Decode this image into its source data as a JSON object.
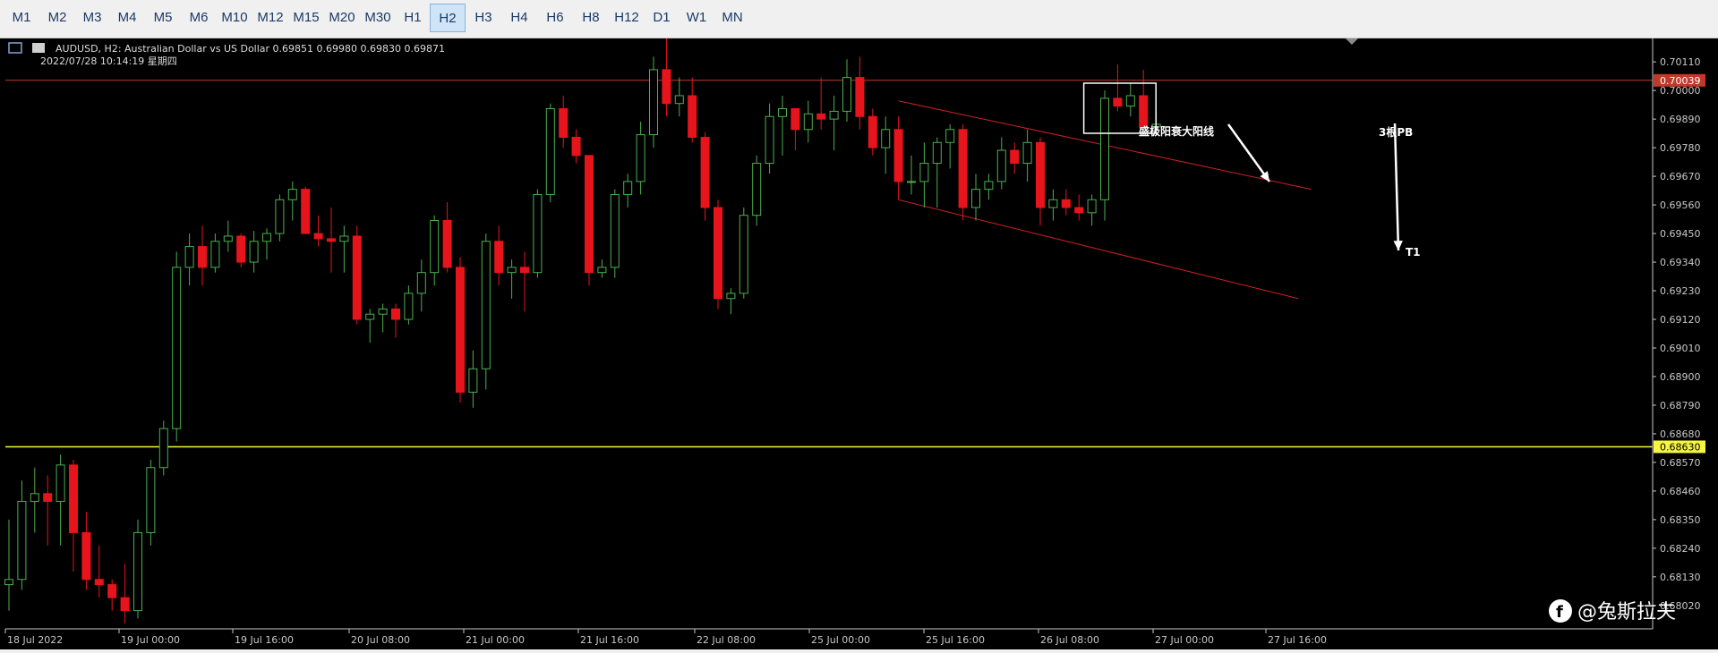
{
  "toolbar": {
    "timeframes": [
      "M1",
      "M2",
      "M3",
      "M4",
      "M5",
      "M6",
      "M10",
      "M12",
      "M15",
      "M20",
      "M30",
      "H1",
      "H2",
      "H3",
      "H4",
      "H6",
      "H8",
      "H12",
      "D1",
      "W1",
      "MN"
    ],
    "active": "H2"
  },
  "chart_header": {
    "symbol_line": "AUDUSD, H2:  Australian Dollar vs US Dollar  0.69851 0.69980 0.69830 0.69871",
    "datetime_line": "2022/07/28  10:14:19  星期四"
  },
  "annotations": {
    "label_big_candle": "盛极阳衰大阳线",
    "label_3pb": "3根PB",
    "label_t1": "T1"
  },
  "watermark": {
    "text": "@兔斯拉夫",
    "icon": "facebook-icon"
  },
  "colors": {
    "bull": "#4caf50",
    "bear": "#e8141c",
    "grid_text": "#c8c8c8",
    "support": "#f5f542",
    "resistance": "#c0392b",
    "channel": "#d02020"
  },
  "chart_data": {
    "type": "candlestick",
    "symbol": "AUDUSD",
    "timeframe": "H2",
    "y_ticks": [
      0.7011,
      0.7,
      0.6989,
      0.6978,
      0.6967,
      0.6956,
      0.6945,
      0.6934,
      0.6923,
      0.6912,
      0.6901,
      0.689,
      0.6879,
      0.6868,
      0.6857,
      0.6846,
      0.6835,
      0.6824,
      0.6813,
      0.6802
    ],
    "ylim": [
      0.6793,
      0.702
    ],
    "x_labels": [
      "18 Jul 2022",
      "19 Jul 00:00",
      "19 Jul 16:00",
      "20 Jul 08:00",
      "21 Jul 00:00",
      "21 Jul 16:00",
      "22 Jul 08:00",
      "25 Jul 00:00",
      "25 Jul 16:00",
      "26 Jul 08:00",
      "27 Jul 00:00",
      "27 Jul 16:00"
    ],
    "current_price": 0.70039,
    "support_level": 0.6863,
    "candles": [
      [
        0.681,
        0.6835,
        0.68,
        0.6812
      ],
      [
        0.6812,
        0.685,
        0.6808,
        0.6842
      ],
      [
        0.6842,
        0.6855,
        0.683,
        0.6845
      ],
      [
        0.6845,
        0.6852,
        0.6825,
        0.6842
      ],
      [
        0.6842,
        0.686,
        0.6825,
        0.6856
      ],
      [
        0.6856,
        0.6858,
        0.6815,
        0.683
      ],
      [
        0.683,
        0.6838,
        0.6808,
        0.6812
      ],
      [
        0.6812,
        0.6825,
        0.6805,
        0.681
      ],
      [
        0.681,
        0.6812,
        0.68,
        0.6805
      ],
      [
        0.6805,
        0.6818,
        0.6795,
        0.68
      ],
      [
        0.68,
        0.6835,
        0.6797,
        0.683
      ],
      [
        0.683,
        0.6858,
        0.6825,
        0.6855
      ],
      [
        0.6855,
        0.6873,
        0.6852,
        0.687
      ],
      [
        0.687,
        0.6938,
        0.6865,
        0.6932
      ],
      [
        0.6932,
        0.6945,
        0.6925,
        0.694
      ],
      [
        0.694,
        0.6948,
        0.6925,
        0.6932
      ],
      [
        0.6932,
        0.6945,
        0.693,
        0.6942
      ],
      [
        0.6942,
        0.695,
        0.6938,
        0.6944
      ],
      [
        0.6944,
        0.6945,
        0.6932,
        0.6934
      ],
      [
        0.6934,
        0.6946,
        0.693,
        0.6942
      ],
      [
        0.6942,
        0.6947,
        0.6935,
        0.6945
      ],
      [
        0.6945,
        0.696,
        0.6942,
        0.6958
      ],
      [
        0.6958,
        0.6965,
        0.695,
        0.6962
      ],
      [
        0.6962,
        0.6963,
        0.6945,
        0.6945
      ],
      [
        0.6945,
        0.6952,
        0.694,
        0.6943
      ],
      [
        0.6943,
        0.6955,
        0.693,
        0.6942
      ],
      [
        0.6942,
        0.6948,
        0.693,
        0.6944
      ],
      [
        0.6944,
        0.6948,
        0.691,
        0.6912
      ],
      [
        0.6912,
        0.6916,
        0.6903,
        0.6914
      ],
      [
        0.6914,
        0.6918,
        0.6907,
        0.6916
      ],
      [
        0.6916,
        0.6918,
        0.6905,
        0.6912
      ],
      [
        0.6912,
        0.6925,
        0.691,
        0.6922
      ],
      [
        0.6922,
        0.6935,
        0.6915,
        0.693
      ],
      [
        0.693,
        0.6952,
        0.6925,
        0.695
      ],
      [
        0.695,
        0.6957,
        0.693,
        0.6932
      ],
      [
        0.6932,
        0.6936,
        0.688,
        0.6884
      ],
      [
        0.6884,
        0.69,
        0.6878,
        0.6893
      ],
      [
        0.6893,
        0.6945,
        0.6885,
        0.6942
      ],
      [
        0.6942,
        0.6948,
        0.6925,
        0.693
      ],
      [
        0.693,
        0.6935,
        0.692,
        0.6932
      ],
      [
        0.6932,
        0.6938,
        0.6915,
        0.693
      ],
      [
        0.693,
        0.6962,
        0.6928,
        0.696
      ],
      [
        0.696,
        0.6995,
        0.6957,
        0.6993
      ],
      [
        0.6993,
        0.6998,
        0.6978,
        0.6982
      ],
      [
        0.6982,
        0.6985,
        0.6972,
        0.6975
      ],
      [
        0.6975,
        0.6975,
        0.6925,
        0.693
      ],
      [
        0.693,
        0.6935,
        0.6928,
        0.6932
      ],
      [
        0.6932,
        0.6962,
        0.6928,
        0.696
      ],
      [
        0.696,
        0.6968,
        0.6955,
        0.6965
      ],
      [
        0.6965,
        0.6988,
        0.696,
        0.6983
      ],
      [
        0.6983,
        0.7013,
        0.6978,
        0.7008
      ],
      [
        0.7008,
        0.702,
        0.699,
        0.6995
      ],
      [
        0.6995,
        0.7005,
        0.699,
        0.6998
      ],
      [
        0.6998,
        0.7005,
        0.698,
        0.6982
      ],
      [
        0.6982,
        0.6984,
        0.695,
        0.6955
      ],
      [
        0.6955,
        0.6958,
        0.6916,
        0.692
      ],
      [
        0.692,
        0.6924,
        0.6914,
        0.6922
      ],
      [
        0.6922,
        0.6955,
        0.692,
        0.6952
      ],
      [
        0.6952,
        0.6975,
        0.6948,
        0.6972
      ],
      [
        0.6972,
        0.6995,
        0.6968,
        0.699
      ],
      [
        0.699,
        0.6998,
        0.6975,
        0.6993
      ],
      [
        0.6993,
        0.6993,
        0.6977,
        0.6985
      ],
      [
        0.6985,
        0.6996,
        0.698,
        0.6991
      ],
      [
        0.6991,
        0.7005,
        0.6985,
        0.6989
      ],
      [
        0.6989,
        0.6998,
        0.6977,
        0.6992
      ],
      [
        0.6992,
        0.7012,
        0.6988,
        0.7005
      ],
      [
        0.7005,
        0.7013,
        0.6985,
        0.699
      ],
      [
        0.699,
        0.6993,
        0.6975,
        0.6978
      ],
      [
        0.6978,
        0.699,
        0.6968,
        0.6985
      ],
      [
        0.6985,
        0.699,
        0.6958,
        0.6965
      ],
      [
        0.6965,
        0.6975,
        0.696,
        0.6965
      ],
      [
        0.6965,
        0.698,
        0.6955,
        0.6972
      ],
      [
        0.6972,
        0.6982,
        0.6955,
        0.698
      ],
      [
        0.698,
        0.6987,
        0.697,
        0.6985
      ],
      [
        0.6985,
        0.6987,
        0.695,
        0.6955
      ],
      [
        0.6955,
        0.6968,
        0.695,
        0.6962
      ],
      [
        0.6962,
        0.6968,
        0.6958,
        0.6965
      ],
      [
        0.6965,
        0.6982,
        0.6962,
        0.6977
      ],
      [
        0.6977,
        0.698,
        0.6968,
        0.6972
      ],
      [
        0.6972,
        0.6985,
        0.6965,
        0.698
      ],
      [
        0.698,
        0.6982,
        0.6948,
        0.6955
      ],
      [
        0.6955,
        0.6962,
        0.695,
        0.6958
      ],
      [
        0.6958,
        0.6962,
        0.6952,
        0.6955
      ],
      [
        0.6955,
        0.696,
        0.695,
        0.6953
      ],
      [
        0.6953,
        0.696,
        0.6948,
        0.6958
      ],
      [
        0.6958,
        0.7,
        0.695,
        0.6997
      ],
      [
        0.6997,
        0.701,
        0.6992,
        0.6994
      ],
      [
        0.6994,
        0.7003,
        0.699,
        0.6998
      ],
      [
        0.6998,
        0.7008,
        0.6985,
        0.6986
      ],
      [
        0.6986,
        0.6992,
        0.6983,
        0.6987
      ]
    ],
    "channel": {
      "upper": [
        [
          0.6996,
          0.6962
        ]
      ],
      "lower": [
        [
          0.6958,
          0.692
        ]
      ]
    },
    "annotation_box": {
      "first": 84,
      "last": 88
    }
  }
}
